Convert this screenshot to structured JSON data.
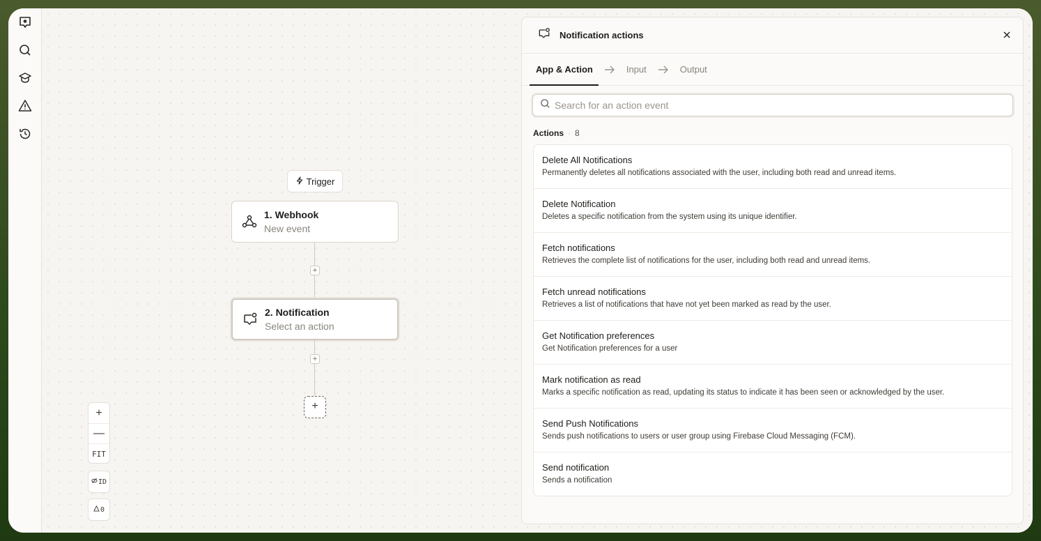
{
  "sidebar": {
    "icons": [
      "logo-icon",
      "search-icon",
      "learn-icon",
      "alert-icon",
      "history-icon"
    ]
  },
  "canvas": {
    "trigger_label": "Trigger",
    "nodes": [
      {
        "title": "1. Webhook",
        "subtitle": "New event",
        "icon": "webhook-icon"
      },
      {
        "title": "2. Notification",
        "subtitle": "Select an action",
        "icon": "notification-icon"
      }
    ],
    "add_symbol": "+",
    "controls": {
      "zoom_in": "+",
      "zoom_out": "—",
      "fit": "FIT",
      "id_toggle": "ID",
      "warnings_count": "0"
    }
  },
  "panel": {
    "title": "Notification actions",
    "tabs": [
      {
        "label": "App & Action",
        "active": true
      },
      {
        "label": "Input",
        "active": false
      },
      {
        "label": "Output",
        "active": false
      }
    ],
    "search": {
      "placeholder": "Search for an action event",
      "value": ""
    },
    "actions_label": "Actions",
    "actions_count": "8",
    "actions": [
      {
        "title": "Delete All Notifications",
        "description": "Permanently deletes all notifications associated with the user, including both read and unread items."
      },
      {
        "title": "Delete Notification",
        "description": "Deletes a specific notification from the system using its unique identifier."
      },
      {
        "title": "Fetch notifications",
        "description": "Retrieves the complete list of notifications for the user, including both read and unread items."
      },
      {
        "title": "Fetch unread notifications",
        "description": "Retrieves a list of notifications that have not yet been marked as read by the user."
      },
      {
        "title": "Get Notification preferences",
        "description": "Get Notification preferences for a user"
      },
      {
        "title": "Mark notification as read",
        "description": "Marks a specific notification as read, updating its status to indicate it has been seen or acknowledged by the user."
      },
      {
        "title": "Send Push Notifications",
        "description": "Sends push notifications to users or user group using Firebase Cloud Messaging (FCM)."
      },
      {
        "title": "Send notification",
        "description": "Sends a notification"
      }
    ]
  },
  "colors": {
    "background_outer": "#3f5424",
    "canvas": "#f7f5f1",
    "accent_text": "#1f1d1a"
  }
}
